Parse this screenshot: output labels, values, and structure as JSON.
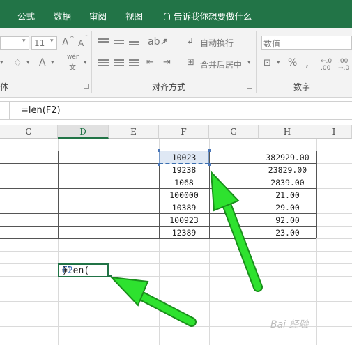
{
  "ribbon_tabs": [
    "公式",
    "数据",
    "审阅",
    "视图"
  ],
  "tell_me": "告诉我你想要做什么",
  "ribbon": {
    "font_size": "11",
    "grow_font": "A",
    "shrink_font": "A",
    "font_color": "A",
    "phonetic": "wén",
    "wrap_text": "自动换行",
    "merge_center": "合并后居中",
    "number_format": "数值",
    "percent": "%",
    "comma": ",",
    "increase_decimal": "←.0 .00",
    "decrease_decimal": ".00 →.0",
    "group_font_tail": "体",
    "group_alignment": "对齐方式",
    "group_number": "数字"
  },
  "formula_bar": {
    "formula": "=len(F2)"
  },
  "columns": [
    "C",
    "D",
    "E",
    "F",
    "G",
    "H",
    "I"
  ],
  "selected_column": "D",
  "col_f_values": [
    "10023",
    "19238",
    "1068",
    "100000",
    "10389",
    "100923",
    "12389"
  ],
  "col_h_values": [
    "382929.00",
    "23829.00",
    "2839.00",
    "21.00",
    "29.00",
    "92.00",
    "23.00"
  ],
  "editing_cell": {
    "prefix": "=len(",
    "ref": "F2",
    "suffix": ")"
  },
  "watermark": "Bai 经验",
  "colors": {
    "ribbon_green": "#227447",
    "arrow_green": "#26e22a",
    "select_blue": "#dfe8f4"
  }
}
